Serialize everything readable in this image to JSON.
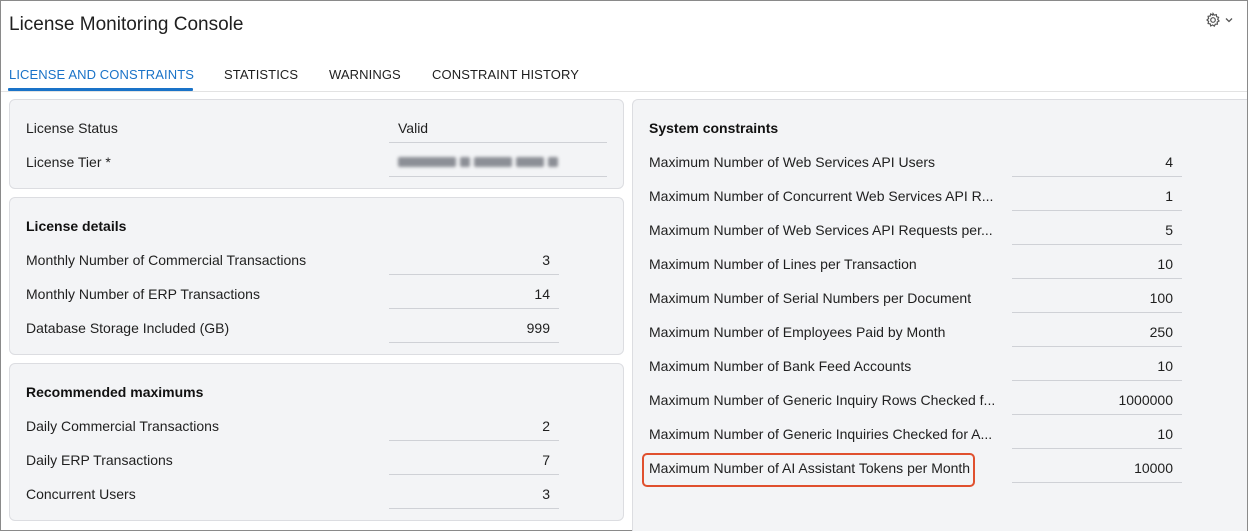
{
  "app": {
    "title": "License Monitoring Console",
    "settings_icon": "gear-icon",
    "menu_icon": "chevron-down-icon"
  },
  "tabs": [
    {
      "label": "LICENSE AND CONSTRAINTS",
      "active": true
    },
    {
      "label": "STATISTICS",
      "active": false
    },
    {
      "label": "WARNINGS",
      "active": false
    },
    {
      "label": "CONSTRAINT HISTORY",
      "active": false
    }
  ],
  "license_summary": {
    "status_label": "License Status",
    "status_value": "Valid",
    "tier_label": "License Tier *",
    "tier_value_redacted": true
  },
  "license_details": {
    "heading": "License details",
    "rows": [
      {
        "label": "Monthly Number of Commercial Transactions",
        "value": "3"
      },
      {
        "label": "Monthly Number of ERP Transactions",
        "value": "14"
      },
      {
        "label": "Database Storage Included (GB)",
        "value": "999"
      }
    ]
  },
  "recommended": {
    "heading": "Recommended maximums",
    "rows": [
      {
        "label": "Daily Commercial Transactions",
        "value": "2"
      },
      {
        "label": "Daily ERP Transactions",
        "value": "7"
      },
      {
        "label": "Concurrent Users",
        "value": "3"
      }
    ]
  },
  "system_constraints": {
    "heading": "System constraints",
    "rows": [
      {
        "label": "Maximum Number of Web Services API Users",
        "value": "4"
      },
      {
        "label": "Maximum Number of Concurrent Web Services API R...",
        "value": "1"
      },
      {
        "label": "Maximum Number of Web Services API Requests per...",
        "value": "5"
      },
      {
        "label": "Maximum Number of Lines per Transaction",
        "value": "10"
      },
      {
        "label": "Maximum Number of Serial Numbers per Document",
        "value": "100"
      },
      {
        "label": "Maximum Number of Employees Paid by Month",
        "value": "250"
      },
      {
        "label": "Maximum Number of Bank Feed Accounts",
        "value": "10"
      },
      {
        "label": "Maximum Number of Generic Inquiry Rows Checked f...",
        "value": "1000000"
      },
      {
        "label": "Maximum Number of Generic Inquiries Checked for A...",
        "value": "10"
      },
      {
        "label": "Maximum Number of AI Assistant Tokens per Month",
        "value": "10000",
        "highlighted": true
      }
    ]
  },
  "colors": {
    "accent": "#1a73c8",
    "highlight": "#e0502e",
    "panel_bg": "#f3f4f6"
  }
}
